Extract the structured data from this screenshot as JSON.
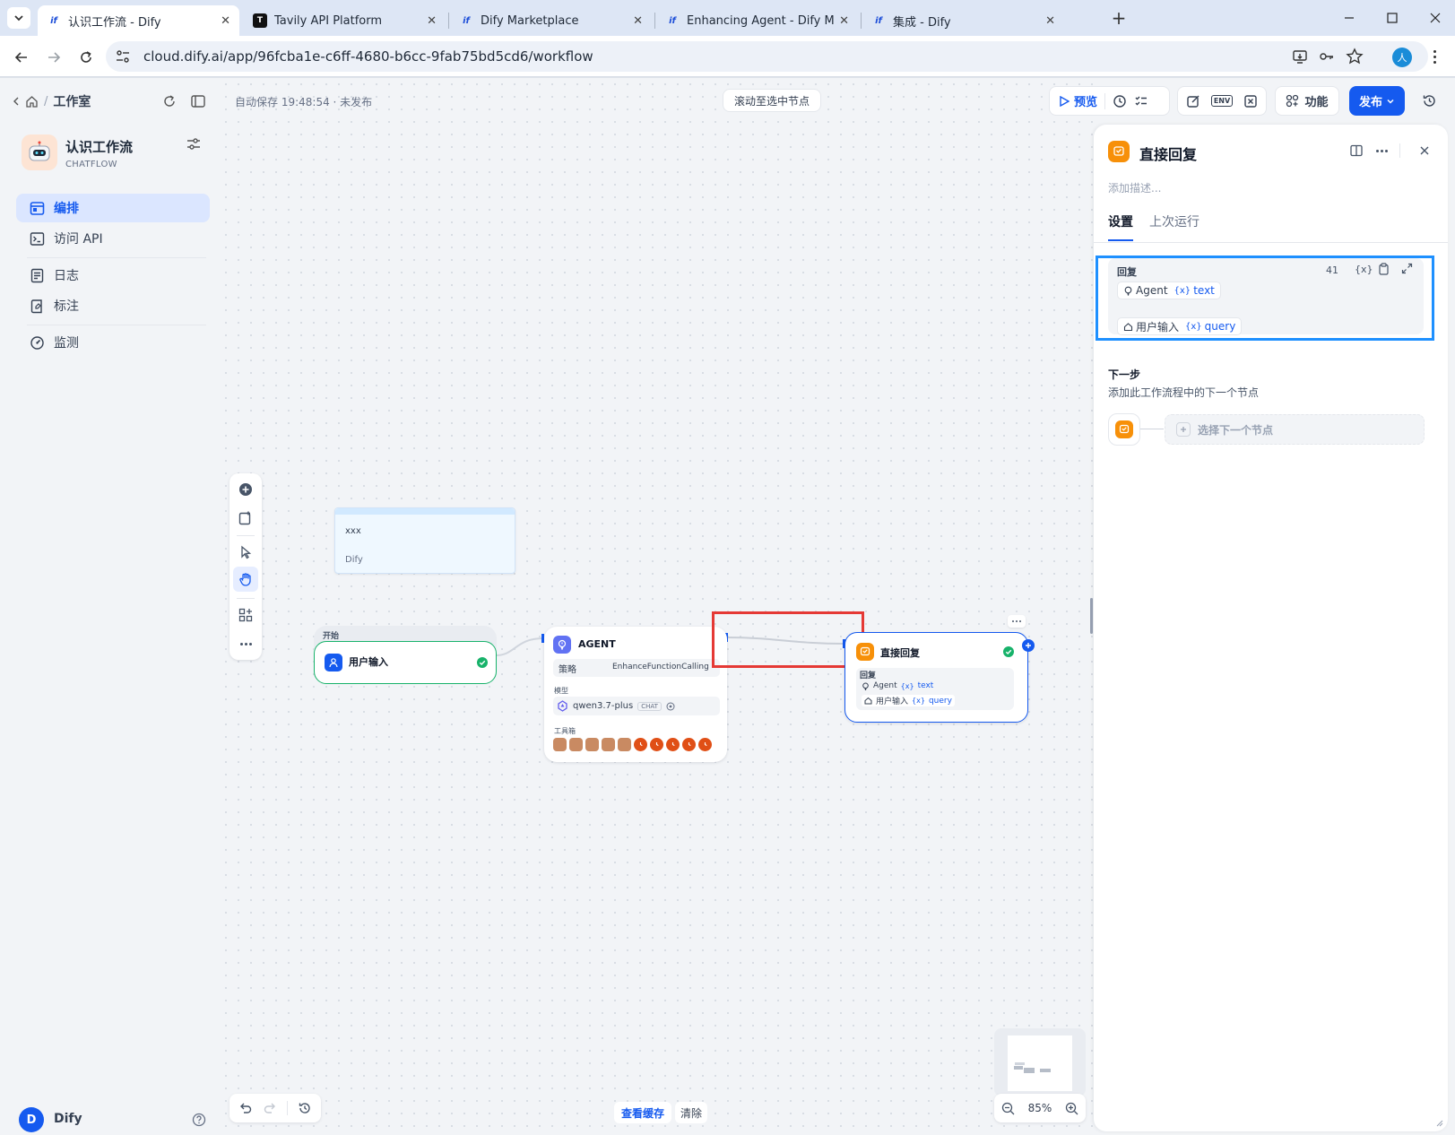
{
  "browser": {
    "tabs": [
      {
        "title": "认识工作流 - Dify",
        "favicon": "dify-icon",
        "active": true
      },
      {
        "title": "Tavily API Platform",
        "favicon": "tavily-icon",
        "active": false
      },
      {
        "title": "Dify Marketplace",
        "favicon": "dify-icon",
        "active": false
      },
      {
        "title": "Enhancing Agent - Dify Mark",
        "favicon": "dify-icon",
        "active": false
      },
      {
        "title": "集成 - Dify",
        "favicon": "dify-icon",
        "active": false
      }
    ],
    "url": "cloud.dify.ai/app/96fcba1e-c6ff-4680-b6cc-9fab75bd5cd6/workflow",
    "profile_initial": "人"
  },
  "sidebar": {
    "breadcrumb_label": "工作室",
    "app_name": "认识工作流",
    "app_mode": "CHATFLOW",
    "nav": [
      {
        "label": "编排",
        "icon": "workflow-icon",
        "active": true
      },
      {
        "label": "访问 API",
        "icon": "terminal-icon",
        "active": false
      },
      {
        "label": "日志",
        "icon": "file-list-icon",
        "active": false
      },
      {
        "label": "标注",
        "icon": "annotation-icon",
        "active": false
      },
      {
        "label": "监测",
        "icon": "gauge-icon",
        "active": false
      }
    ],
    "workspace_initial": "D",
    "workspace_name": "Dify"
  },
  "canvas": {
    "autosave_text": "自动保存 19:48:54 · 未发布",
    "scroll_to_selected": "滚动至选中节点",
    "toolbar": {
      "preview": "预览",
      "features": "功能",
      "publish": "发布"
    },
    "note": {
      "text": "xxx",
      "author": "Dify"
    },
    "start_node": {
      "header": "开始",
      "title": "用户输入"
    },
    "agent_node": {
      "title": "AGENT",
      "strategy_label": "策略",
      "strategy_value": "EnhanceFunctionCalling",
      "model_label": "模型",
      "model_name": "qwen3.7-plus",
      "model_badge": "CHAT",
      "tools_label": "工具箱",
      "tool_count_brown": 5,
      "tool_count_red": 5
    },
    "answer_node": {
      "title": "直接回复",
      "section_label": "回复",
      "vars": [
        {
          "source": "Agent",
          "name": "text"
        },
        {
          "source": "用户输入",
          "name": "query"
        }
      ]
    },
    "bottom": {
      "view_cache": "查看缓存",
      "clear": "清除",
      "zoom": "85%"
    }
  },
  "panel": {
    "title": "直接回复",
    "description_placeholder": "添加描述...",
    "tabs": [
      {
        "label": "设置",
        "active": true
      },
      {
        "label": "上次运行",
        "active": false
      }
    ],
    "reply": {
      "label": "回复",
      "count": "41",
      "vars": [
        {
          "source": "Agent",
          "name": "text"
        },
        {
          "source": "用户输入",
          "name": "query"
        }
      ]
    },
    "next_step": {
      "title": "下一步",
      "desc": "添加此工作流程中的下一个节点",
      "select_label": "选择下一个节点"
    }
  },
  "colors": {
    "primary": "#155aef",
    "answer_orange": "#f79009",
    "highlight_red": "#e53935",
    "highlight_blue": "#1e90ff",
    "success_green": "#17b26a"
  }
}
